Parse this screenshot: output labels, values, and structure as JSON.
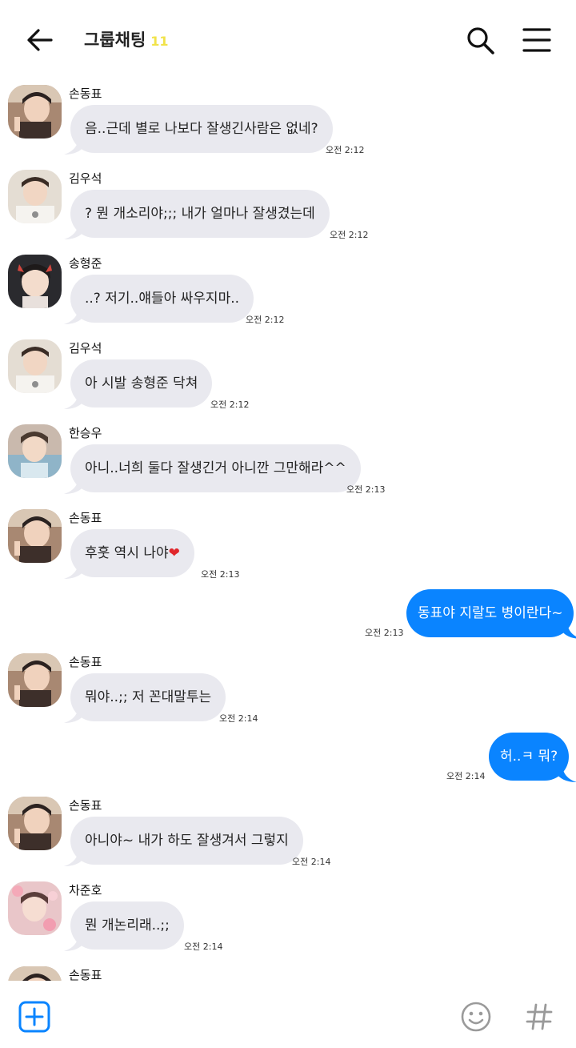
{
  "header": {
    "title": "그룹채팅",
    "member_count": "11",
    "back_icon": "arrow-left-icon",
    "search_icon": "search-icon",
    "menu_icon": "hamburger-menu-icon"
  },
  "colors": {
    "my_bubble": "#0a84ff",
    "their_bubble": "#e9e9ef",
    "count": "#f1e34a",
    "heart": "#e0262b"
  },
  "messages": [
    {
      "sender": "손동표",
      "text": "음..근데 별로 나보다 잘생긴사람은 없네?",
      "time": "오전 2:12"
    },
    {
      "sender": "김우석",
      "text": "? 뭔 개소리야;;; 내가 얼마나 잘생겼는데",
      "time": "오전 2:12"
    },
    {
      "sender": "송형준",
      "text": "..? 저기..얘들아 싸우지마..",
      "time": "오전 2:12"
    },
    {
      "sender": "김우석",
      "text": "아 시발 송형준 닥쳐",
      "time": "오전 2:12"
    },
    {
      "sender": "한승우",
      "text": "아니..너희 둘다 잘생긴거 아니깐 그만해라^^",
      "time": "오전 2:13"
    },
    {
      "sender": "손동표",
      "text": "후훗 역시 나야",
      "emoji": "❤",
      "time": "오전 2:13"
    },
    {
      "mine": true,
      "text": "동표야 지랄도 병이란다~",
      "time": "오전 2:13"
    },
    {
      "sender": "손동표",
      "text": "뭐야..;; 저 꼰대말투는",
      "time": "오전 2:14"
    },
    {
      "mine": true,
      "text": "허..ㅋ 뭐?",
      "time": "오전 2:14"
    },
    {
      "sender": "손동표",
      "text": "아니야~ 내가 하도 잘생겨서 그렇지",
      "time": "오전 2:14"
    },
    {
      "sender": "차준호",
      "text": "뭔 개논리래..;;",
      "time": "오전 2:14"
    },
    {
      "sender": "손동표"
    }
  ],
  "bottom_bar": {
    "plus_icon": "add-plus-icon",
    "emoji_icon": "emoji-smile-icon",
    "hashtag_icon": "hashtag-icon"
  }
}
